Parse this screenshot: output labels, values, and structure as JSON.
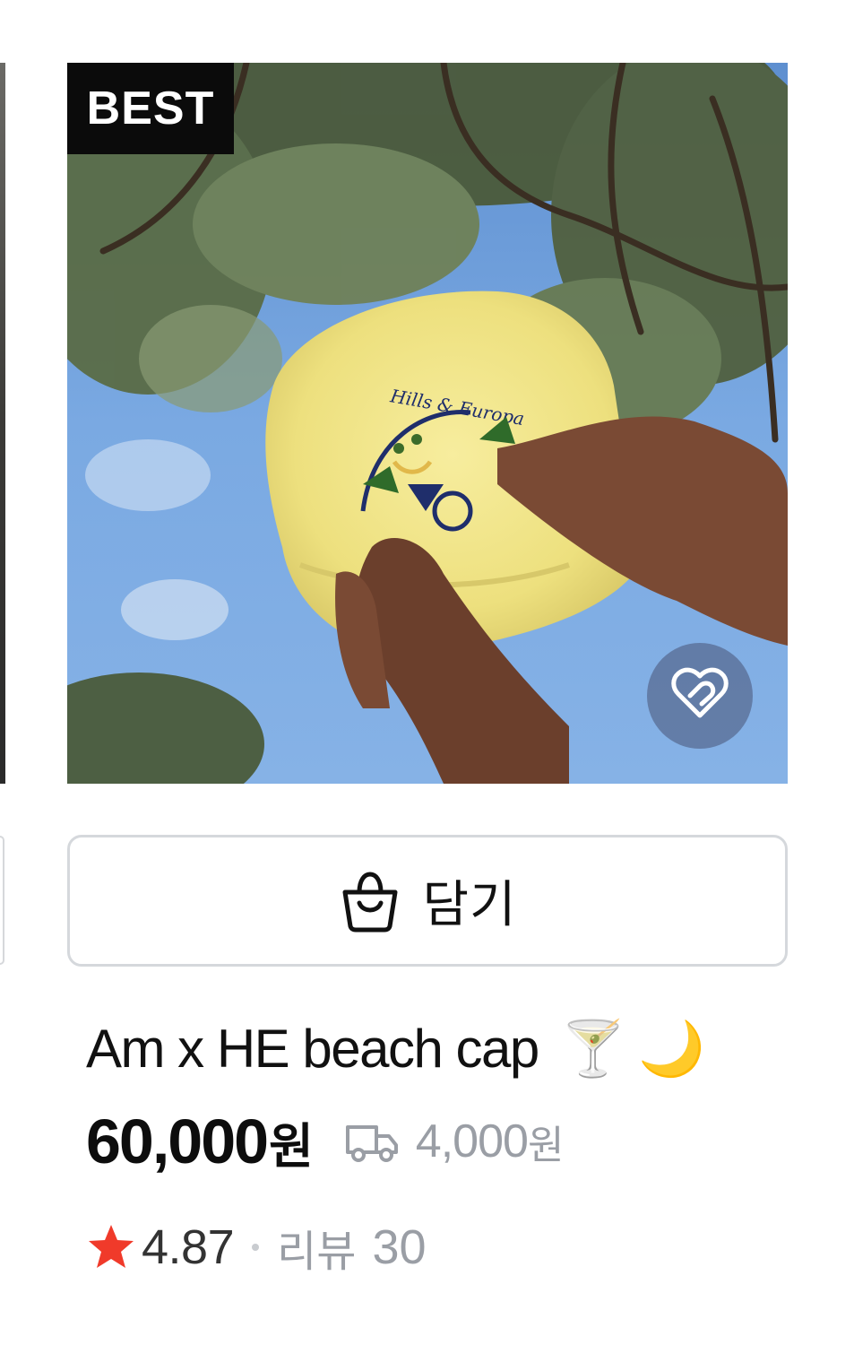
{
  "product": {
    "badge": "BEST",
    "image_alt": "Yellow cap with \"Hills & Europa\" / \"Abandoned martini\" embroidery held up against trees and sky",
    "image_text": "Hills & Europa",
    "name": "Am x HE beach cap",
    "name_emoji": [
      "🍸",
      "🌙"
    ],
    "price": "60,000",
    "price_unit": "원",
    "shipping_fee": "4,000",
    "shipping_unit": "원",
    "rating": "4.87",
    "review_label": "리뷰",
    "review_count": "30"
  },
  "actions": {
    "cart_label": "담기"
  },
  "icons": {
    "wish": "heart-outline-icon",
    "cart": "shopping-bag-icon",
    "shipping": "delivery-truck-icon",
    "rating": "star-icon"
  },
  "colors": {
    "badge_bg": "#0b0b0b",
    "star": "#f03a2a",
    "muted_text": "#9a9ea5",
    "button_border": "#d5d8dc",
    "wish_bg": "#5a6e96"
  }
}
